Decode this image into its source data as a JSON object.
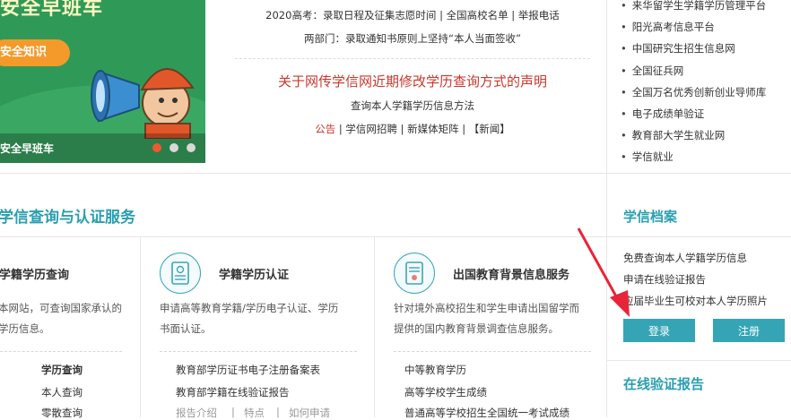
{
  "banner": {
    "headline": "安全早班车",
    "pill": "安全知识",
    "caption": "安全早班车",
    "dots": 3
  },
  "news": {
    "line1": "2020高考：录取日程及征集志愿时间 | 全国高校名单  |  举报电话",
    "line2": "两部门：录取通知书原则上坚持“本人当面签收”",
    "headline": "关于网传学信网近期修改学历查询方式的声明",
    "subline": "查询本人学籍学历信息方法",
    "tag": "公告",
    "tail": "| 学信网招聘 | 新媒体矩阵 | 【新闻】"
  },
  "links": [
    "来华留学生学籍学历管理平台",
    "阳光高考信息平台",
    "中国研究生招生信息网",
    "全国征兵网",
    "全国万名优秀创新创业导师库",
    "电子成绩单验证",
    "教育部大学生就业网",
    "学信就业"
  ],
  "services": {
    "section_title": "学信查询与认证服务",
    "card1": {
      "title": "学籍学历查询",
      "desc_line1": "本网站，可查询国家承认的",
      "desc_line2": "学历信息。",
      "links": [
        "学历查询",
        "本人查询",
        "零散查询"
      ]
    },
    "card2": {
      "title": "学籍学历认证",
      "desc_line1": "申请高等教育学籍/学历电子认证、学历",
      "desc_line2": "书面认证。",
      "links": [
        "教育部学历证书电子注册备案表",
        "教育部学籍在线验证报告"
      ],
      "sub_links": [
        "报告介绍",
        "特点",
        "如何申请"
      ]
    },
    "card3": {
      "title": "出国教育背景信息服务",
      "desc_line1": "针对境外高校招生和学生申请出国留学而",
      "desc_line2": "提供的国内教育背景调查信息服务。",
      "links": [
        "中等教育学历",
        "高等学校学生成绩",
        "普通高等学校招生全国统一考试成绩"
      ]
    }
  },
  "archive": {
    "title": "学信档案",
    "links": [
      "免费查询本人学籍学历信息",
      "申请在线验证报告",
      "应届毕业生可校对本人学历照片"
    ],
    "login": "登录",
    "register": "注册"
  },
  "verify": {
    "title": "在线验证报告"
  },
  "colors": {
    "accent": "#2a9fb1",
    "button": "#35a5b5",
    "headline_red": "#c9372c",
    "banner_green": "#2f9a57",
    "annotation_arrow": "#e8243a"
  }
}
